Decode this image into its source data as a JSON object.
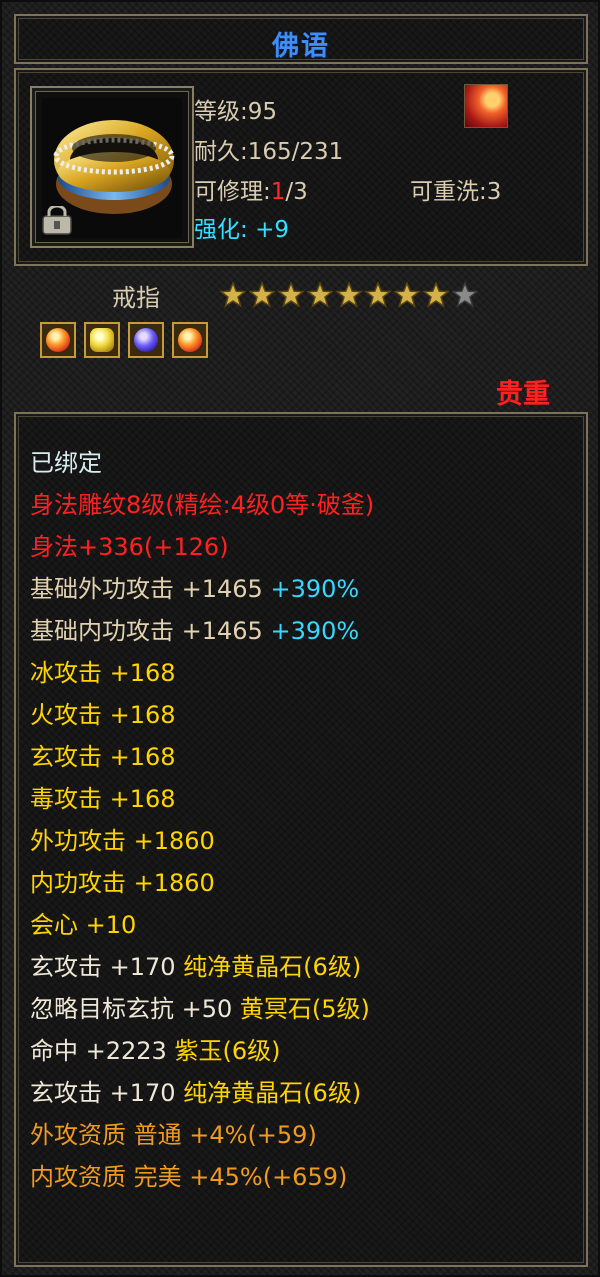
{
  "title": "佛语",
  "info": {
    "level_label": "等级:",
    "level_value": "95",
    "durability_label": "耐久:",
    "durability_value": "165/231",
    "repair_label": "可修理:",
    "repair_current": "1",
    "repair_max": "/3",
    "reforge_label": "可重洗:",
    "reforge_value": "3",
    "enhance_label": "强化: ",
    "enhance_value": "+9"
  },
  "item_type": "戒指",
  "stars": {
    "filled": 8,
    "total": 9
  },
  "gems": [
    "fire-gem-icon",
    "gold-gem-icon",
    "purple-gem-icon",
    "fire-gem-icon"
  ],
  "rarity": "贵重",
  "stats": {
    "bound": "已绑定",
    "engrave": "身法雕纹8级(精绘:4级0等·破釜)",
    "agility": "身法+336(+126)",
    "base_ext_label": "基础外功攻击 +1465 ",
    "base_ext_pct": "+390%",
    "base_int_label": "基础内功攻击 +1465 ",
    "base_int_pct": "+390%",
    "ice": "冰攻击 +168",
    "fire": "火攻击 +168",
    "mystic": "玄攻击 +168",
    "poison": "毒攻击 +168",
    "ext_atk": "外功攻击 +1860",
    "int_atk": "内功攻击 +1860",
    "crit": "会心 +10",
    "gem1_stat": "玄攻击 +170 ",
    "gem1_name": "纯净黄晶石(6级)",
    "gem2_stat": "忽略目标玄抗 +50 ",
    "gem2_name": "黄冥石(5级)",
    "gem3_stat": "命中 +2223 ",
    "gem3_name": "紫玉(6级)",
    "gem4_stat": "玄攻击 +170 ",
    "gem4_name": "纯净黄晶石(6级)",
    "apt_ext": "外攻资质 普通 +4%(+59)",
    "apt_int": "内攻资质 完美 +45%(+659)"
  },
  "colors": {
    "title": "#3f8df7",
    "rarity": "#ff2020",
    "enhance": "#33e0ff",
    "gem_name": "#ffd400",
    "aptitude": "#f09a20"
  }
}
